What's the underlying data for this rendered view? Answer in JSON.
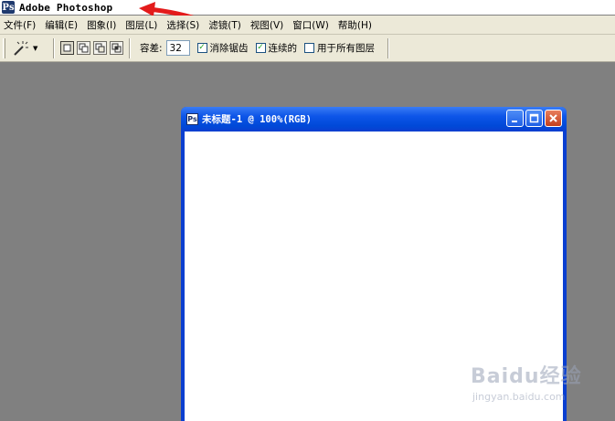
{
  "app": {
    "title": "Adobe Photoshop",
    "icon": "photoshop-icon"
  },
  "menu": {
    "items": [
      "文件(F)",
      "编辑(E)",
      "图象(I)",
      "图层(L)",
      "选择(S)",
      "滤镜(T)",
      "视图(V)",
      "窗口(W)",
      "帮助(H)"
    ]
  },
  "options": {
    "tool_icon": "magic-wand-icon",
    "selection_modes": [
      "new-selection-icon",
      "add-to-selection-icon",
      "subtract-from-selection-icon",
      "intersect-selection-icon"
    ],
    "tolerance_label": "容差:",
    "tolerance_value": "32",
    "anti_alias": {
      "label": "消除锯齿",
      "checked": true
    },
    "contiguous": {
      "label": "连续的",
      "checked": true
    },
    "all_layers": {
      "label": "用于所有图层",
      "checked": false
    }
  },
  "document": {
    "title": "未标题-1 @ 100%(RGB)",
    "buttons": [
      "minimize-icon",
      "maximize-icon",
      "close-icon"
    ]
  },
  "watermark": {
    "text": "Baidu经验",
    "sub": "jingyan.baidu.com"
  },
  "colors": {
    "workspace": "#808080",
    "chrome": "#ece9d8",
    "xp_blue": "#0a3fd0",
    "annotation_arrow": "#e31b1b"
  }
}
